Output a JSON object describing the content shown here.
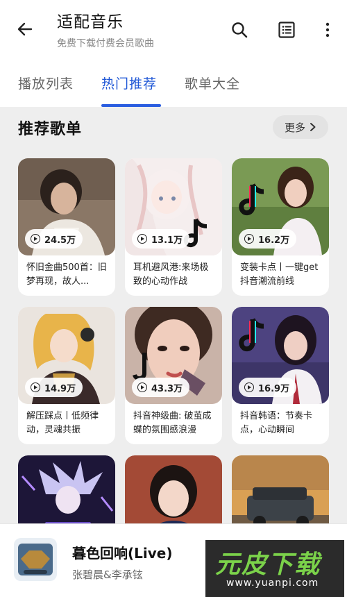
{
  "header": {
    "title": "适配音乐",
    "subtitle": "免费下载付费会员歌曲"
  },
  "tabs": [
    {
      "label": "播放列表"
    },
    {
      "label": "热门推荐"
    },
    {
      "label": "歌单大全"
    }
  ],
  "section": {
    "title": "推荐歌单",
    "more_label": "更多"
  },
  "playlists": [
    {
      "plays": "24.5万",
      "title": "怀旧金曲500首：旧梦再现，故人..."
    },
    {
      "plays": "13.1万",
      "title": "耳机避风港:来场极致的心动作战"
    },
    {
      "plays": "16.2万",
      "title": "变装卡点丨一键get抖音潮流前线"
    },
    {
      "plays": "14.9万",
      "title": "解压踩点丨低频律动，灵魂共振"
    },
    {
      "plays": "43.3万",
      "title": "抖音神级曲: 破茧成蝶的氛围感浪漫"
    },
    {
      "plays": "16.9万",
      "title": "抖音韩语：节奏卡点，心动瞬间"
    }
  ],
  "player": {
    "song": "暮色回响(Live)",
    "artist": "张碧晨&李承铉"
  },
  "watermark": {
    "text": "元皮下载",
    "url": "www.yuanpi.com"
  },
  "colors": {
    "accent": "#1f57d6",
    "content_bg": "#eeeeee"
  }
}
